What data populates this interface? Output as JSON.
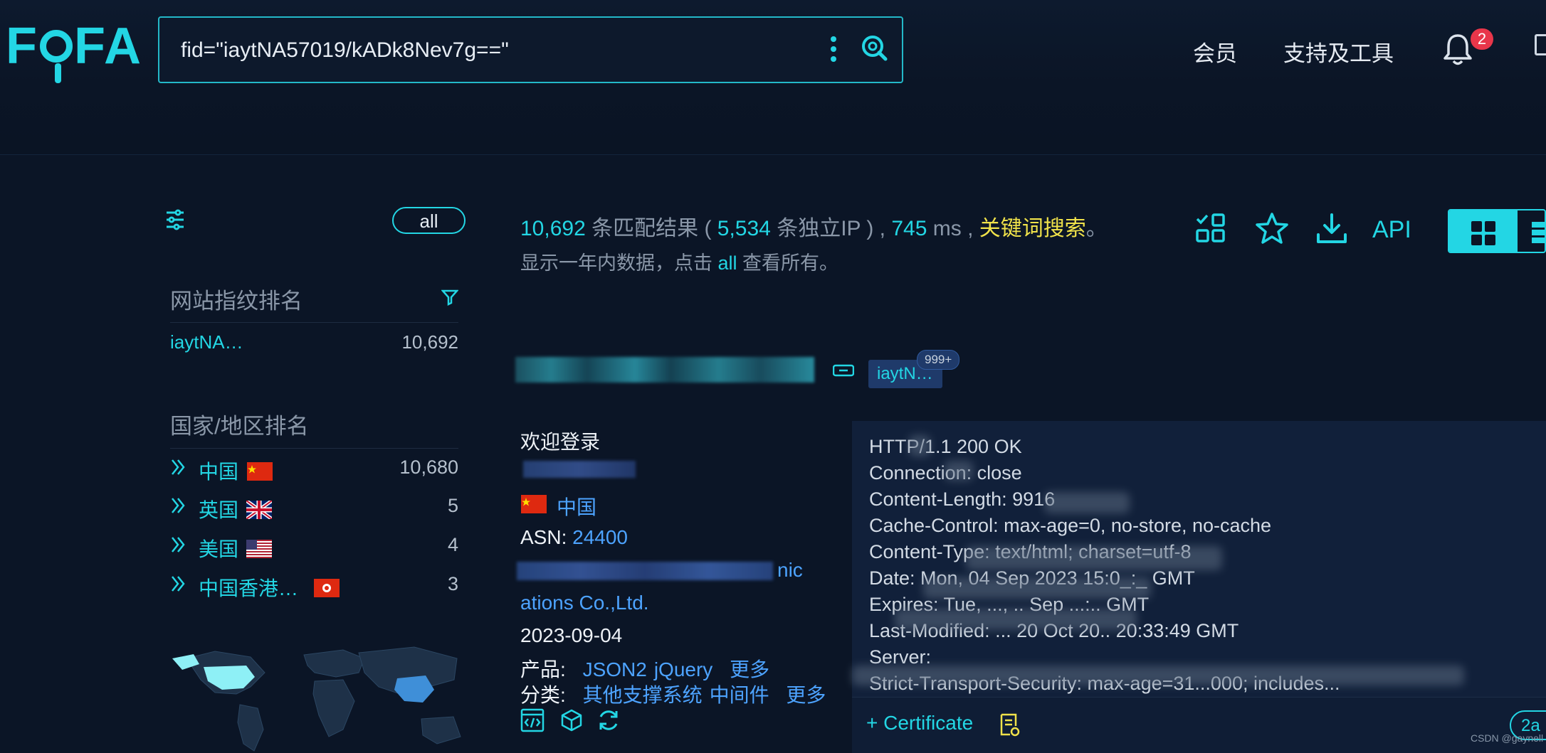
{
  "header": {
    "logo_text": "FOFA",
    "search_value": "fid=\"iaytNA57019/kADk8Nev7g==\"",
    "nav_member": "会员",
    "nav_tools": "支持及工具",
    "notification_count": "2"
  },
  "sidebar": {
    "all_label": "all",
    "fingerprint_title": "网站指纹排名",
    "fingerprint_items": [
      {
        "name": "iaytNA…",
        "count": "10,692"
      }
    ],
    "country_title": "国家/地区排名",
    "countries": [
      {
        "name": "中国",
        "count": "10,680",
        "flag": "cn-flag"
      },
      {
        "name": "英国",
        "count": "5",
        "flag": "uk-flag"
      },
      {
        "name": "美国",
        "count": "4",
        "flag": "us-flag"
      },
      {
        "name": "中国香港…",
        "count": "3",
        "flag": "hk-flag"
      }
    ]
  },
  "results": {
    "total": "10,692",
    "total_suffix": "条匹配结果 (",
    "unique_ip": "5,534",
    "unique_suffix": "条独立IP ) ,",
    "time": "745",
    "time_unit": "ms ,",
    "keyword": "关键词搜索",
    "keyword_suffix": "。",
    "sub_prefix": "显示一年内数据，点击",
    "sub_all": "all",
    "sub_suffix": "查看所有。",
    "api_label": "API"
  },
  "card": {
    "tag_label": "iaytN…",
    "tag_badge": "999+",
    "title": "欢迎登录",
    "country": "中国",
    "asn_label": "ASN:",
    "asn_value": "24400",
    "org_line1_tail": "nic",
    "org_line2": "ations Co.,Ltd.",
    "date": "2023-09-04",
    "product_label": "产品:",
    "products": [
      "JSON2",
      "jQuery"
    ],
    "product_more": "更多",
    "category_label": "分类:",
    "categories": [
      "其他支撑系统",
      "中间件"
    ],
    "category_more": "更多"
  },
  "http_header": {
    "lines": [
      "HTTP/1.1 200 OK",
      "Connection: close",
      "Content-Length: 9916",
      "Cache-Control: max-age=0, no-store, no-cache",
      "Content-Type: text/html; charset=utf-8",
      "Date: Mon, 04 Sep 2023 15:0_:_ GMT",
      "Expires: Tue, ..., .. Sep ...:.. GMT",
      "Last-Modified: ... 20 Oct 20.. 20:33:49 GMT",
      "Server:",
      "Strict-Transport-Security: max-age=31...000; includes..."
    ],
    "certificate_label": "+ Certificate",
    "pill_label": "2a"
  },
  "watermark": "CSDN @gaynell",
  "colors": {
    "accent": "#23d6e4",
    "background": "#0b1526",
    "link": "#4da3ff",
    "keyword": "#f0e24a",
    "badge": "#e8364a"
  }
}
